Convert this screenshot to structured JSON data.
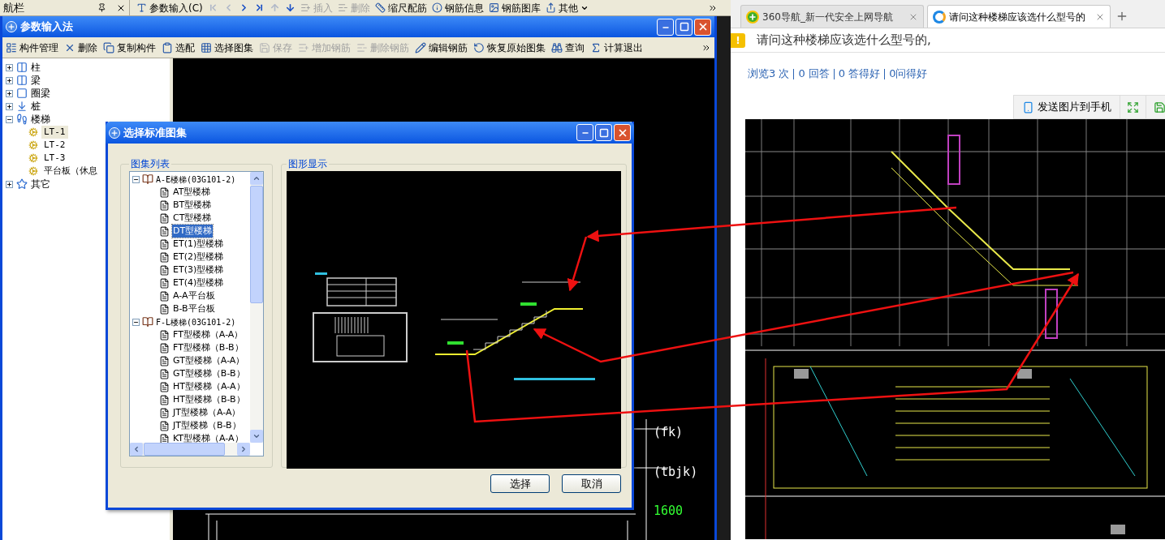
{
  "nav_panel": {
    "title": "航栏"
  },
  "top_toolbar": [
    {
      "kind": "button",
      "label": "参数输入(C)",
      "disabled": false
    },
    {
      "kind": "nav",
      "disabled": true
    },
    {
      "kind": "nav",
      "disabled": true
    },
    {
      "kind": "nav",
      "disabled": false
    },
    {
      "kind": "nav",
      "disabled": false
    },
    {
      "kind": "nav",
      "disabled": true
    },
    {
      "kind": "nav",
      "disabled": false
    },
    {
      "kind": "button",
      "label": "插入",
      "disabled": true
    },
    {
      "kind": "button",
      "label": "删除",
      "disabled": true
    },
    {
      "kind": "button",
      "label": "缩尺配筋",
      "disabled": false
    },
    {
      "kind": "button",
      "label": "钢筋信息",
      "disabled": false
    },
    {
      "kind": "button",
      "label": "钢筋图库",
      "disabled": false
    },
    {
      "kind": "menu",
      "label": "其他",
      "disabled": false
    }
  ],
  "window": {
    "title": "参数输入法",
    "toolbar": [
      {
        "label": "构件管理",
        "disabled": false
      },
      {
        "label": "删除",
        "disabled": false
      },
      {
        "label": "复制构件",
        "disabled": false
      },
      {
        "label": "选配",
        "disabled": false
      },
      {
        "label": "选择图集",
        "disabled": false
      },
      {
        "label": "保存",
        "disabled": true
      },
      {
        "label": "增加钢筋",
        "disabled": true
      },
      {
        "label": "删除钢筋",
        "disabled": true
      },
      {
        "label": "编辑钢筋",
        "disabled": false
      },
      {
        "label": "恢复原始图集",
        "disabled": false
      },
      {
        "label": "查询",
        "disabled": false
      },
      {
        "label": "计算退出",
        "disabled": false
      }
    ],
    "tree": [
      {
        "label": "柱",
        "expanded": false
      },
      {
        "label": "梁",
        "expanded": false
      },
      {
        "label": "圈梁",
        "expanded": false
      },
      {
        "label": "桩",
        "expanded": false
      },
      {
        "label": "楼梯",
        "expanded": true,
        "children": [
          {
            "label": "LT-1",
            "selected": true
          },
          {
            "label": "LT-2",
            "selected": false
          },
          {
            "label": "LT-3",
            "selected": false
          },
          {
            "label": "平台板（休息",
            "selected": false
          }
        ]
      },
      {
        "label": "其它",
        "expanded": false
      }
    ],
    "canvas_labels": [
      {
        "text": "(fk)",
        "color": "#ffffff"
      },
      {
        "text": "(tbjk)",
        "color": "#ffffff"
      },
      {
        "text": "1600",
        "color": "#33ff33"
      }
    ]
  },
  "dialog": {
    "title": "选择标准图集",
    "list_group": "图集列表",
    "tree": [
      {
        "label": "A-E楼梯(03G101-2)",
        "expanded": true,
        "children": [
          {
            "label": "AT型楼梯",
            "selected": false
          },
          {
            "label": "BT型楼梯",
            "selected": false
          },
          {
            "label": "CT型楼梯",
            "selected": false
          },
          {
            "label": "DT型楼梯",
            "selected": true
          },
          {
            "label": "ET(1)型楼梯",
            "selected": false
          },
          {
            "label": "ET(2)型楼梯",
            "selected": false
          },
          {
            "label": "ET(3)型楼梯",
            "selected": false
          },
          {
            "label": "ET(4)型楼梯",
            "selected": false
          },
          {
            "label": "A-A平台板",
            "selected": false
          },
          {
            "label": "B-B平台板",
            "selected": false
          }
        ]
      },
      {
        "label": "F-L楼梯(03G101-2)",
        "expanded": true,
        "children": [
          {
            "label": "FT型楼梯（A-A）",
            "selected": false
          },
          {
            "label": "FT型楼梯（B-B）",
            "selected": false
          },
          {
            "label": "GT型楼梯（A-A）",
            "selected": false
          },
          {
            "label": "GT型楼梯（B-B）",
            "selected": false
          },
          {
            "label": "HT型楼梯（A-A）",
            "selected": false
          },
          {
            "label": "HT型楼梯（B-B）",
            "selected": false
          },
          {
            "label": "JT型楼梯（A-A）",
            "selected": false
          },
          {
            "label": "JT型楼梯（B-B）",
            "selected": false
          },
          {
            "label": "KT型楼梯（A-A）",
            "selected": false
          }
        ]
      }
    ],
    "preview_group": "图形显示",
    "buttons": [
      "选择",
      "取消"
    ]
  },
  "browser": {
    "tabs": [
      {
        "title": "360导航_新一代安全上网导航",
        "selected": false
      },
      {
        "title": "请问这种楼梯应该选什么型号的",
        "selected": true
      }
    ],
    "alert_badge": "!",
    "heading": "请问这种楼梯应该选什么型号的,",
    "stats": [
      "浏览3 次",
      "0 回答",
      "0 答得好",
      "0问得好"
    ],
    "image_toolbar": {
      "send_button": "发送图片到手机"
    }
  }
}
